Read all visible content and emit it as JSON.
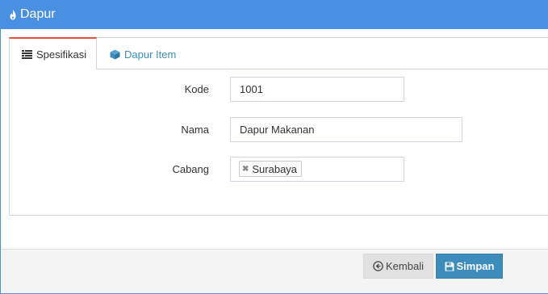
{
  "header": {
    "title": "Dapur",
    "icon": "fire-icon"
  },
  "tabs": [
    {
      "label": "Spesifikasi",
      "icon": "list-icon",
      "active": true
    },
    {
      "label": "Dapur Item",
      "icon": "cube-icon",
      "active": false
    }
  ],
  "form": {
    "kode": {
      "label": "Kode",
      "value": "1001"
    },
    "nama": {
      "label": "Nama",
      "value": "Dapur Makanan"
    },
    "cabang": {
      "label": "Cabang",
      "selected": "Surabaya",
      "remove_symbol": "✖"
    }
  },
  "footer": {
    "back_label": "Kembali",
    "save_label": "Simpan"
  },
  "colors": {
    "header_bg": "#4a90e2",
    "active_tab_accent": "#e84c3d",
    "link": "#3c8dbc",
    "primary_button": "#3c8dbc"
  }
}
